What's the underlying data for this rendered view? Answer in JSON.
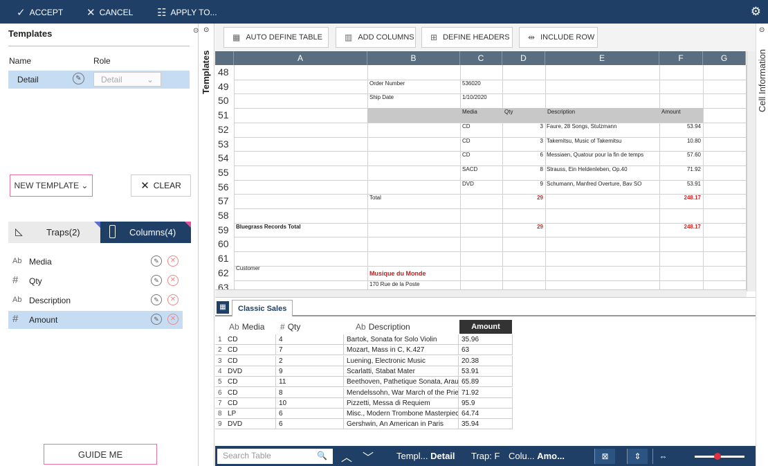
{
  "topbar": {
    "accept": "ACCEPT",
    "cancel": "CANCEL",
    "apply": "APPLY TO..."
  },
  "left": {
    "title": "Templates",
    "hdr_name": "Name",
    "hdr_role": "Role",
    "template": {
      "name": "Detail",
      "role": "Detail"
    },
    "new_template": "NEW TEMPLATE",
    "clear": "CLEAR",
    "tab_traps": "Traps(2)",
    "tab_columns": "Columns(4)",
    "columns": [
      {
        "type": "Ab",
        "name": "Media"
      },
      {
        "type": "#",
        "name": "Qty"
      },
      {
        "type": "Ab",
        "name": "Description"
      },
      {
        "type": "#",
        "name": "Amount"
      }
    ],
    "guide": "GUIDE ME"
  },
  "vtab_left": "Templates",
  "vtab_right": "Cell Information",
  "toolbar": [
    "AUTO DEFINE TABLE",
    "ADD COLUMNS",
    "DEFINE HEADERS",
    "INCLUDE ROW"
  ],
  "sheet": {
    "cols": [
      "A",
      "B",
      "C",
      "D",
      "E",
      "F",
      "G"
    ],
    "rows": [
      "48",
      "49",
      "50",
      "51",
      "52",
      "53",
      "54",
      "55",
      "56",
      "57",
      "58",
      "59",
      "60",
      "61",
      "62",
      "63"
    ],
    "cells": {
      "b49": "Order Number",
      "c49": "536020",
      "b50": "Ship Date",
      "c50": "1/10/2020",
      "c51": "Media",
      "d51": "Qty",
      "e51": "Description",
      "f51": "Amount",
      "c52": "CD",
      "d52": "3",
      "e52": "Faure, 28 Songs, Stulzmann",
      "f52": "53.94",
      "c53": "CD",
      "d53": "3",
      "e53": "Takemitsu, Music of Takemitsu",
      "f53": "10.80",
      "c54": "CD",
      "d54": "6",
      "e54": "Messiaen, Quatour pour la fin de temps",
      "f54": "57.60",
      "c55": "SACD",
      "d55": "8",
      "e55": "Strauss, Ein Heldenleben, Op.40",
      "f55": "71.92",
      "c56": "DVD",
      "d56": "9",
      "e56": "Schumann, Manfred Overture, Bav SO",
      "f56": "53.91",
      "b57": "Total",
      "d57": "29",
      "f57": "248.17",
      "a59": "Bluegrass Records Total",
      "d59": "29",
      "f59": "248.17",
      "a62": "Customer",
      "b62": "Musique du Monde",
      "b63": "170 Rue de la Poste"
    },
    "tab": "Classic Sales"
  },
  "grid": {
    "headers": [
      {
        "type": "Ab",
        "name": "Media"
      },
      {
        "type": "#",
        "name": "Qty"
      },
      {
        "type": "Ab",
        "name": "Description"
      },
      {
        "type": "",
        "name": "Amount"
      }
    ],
    "rows": [
      [
        "1",
        "CD",
        "4",
        "Bartok, Sonata for Solo Violin",
        "35.96"
      ],
      [
        "2",
        "CD",
        "7",
        "Mozart, Mass in C, K.427",
        "63"
      ],
      [
        "3",
        "CD",
        "2",
        "Luening, Electronic Music",
        "20.38"
      ],
      [
        "4",
        "DVD",
        "9",
        "Scarlatti, Stabat Mater",
        "53.91"
      ],
      [
        "5",
        "CD",
        "11",
        "Beethoven, Pathetique Sonata, Arau",
        "65.89"
      ],
      [
        "6",
        "CD",
        "8",
        "Mendelssohn, War March of the Priests",
        "71.92"
      ],
      [
        "7",
        "CD",
        "10",
        "Pizzetti, Messa di Requiem",
        "95.9"
      ],
      [
        "8",
        "LP",
        "6",
        "Misc., Modern Trombone Masterpieces",
        "64.74"
      ],
      [
        "9",
        "DVD",
        "6",
        "Gershwin, An American in Paris",
        "35.94"
      ]
    ]
  },
  "status": {
    "search_placeholder": "Search Table",
    "templ_label": "Templ...",
    "templ_value": "Detail",
    "trap": "Trap: F",
    "colu_label": "Colu...",
    "colu_value": "Amo..."
  }
}
